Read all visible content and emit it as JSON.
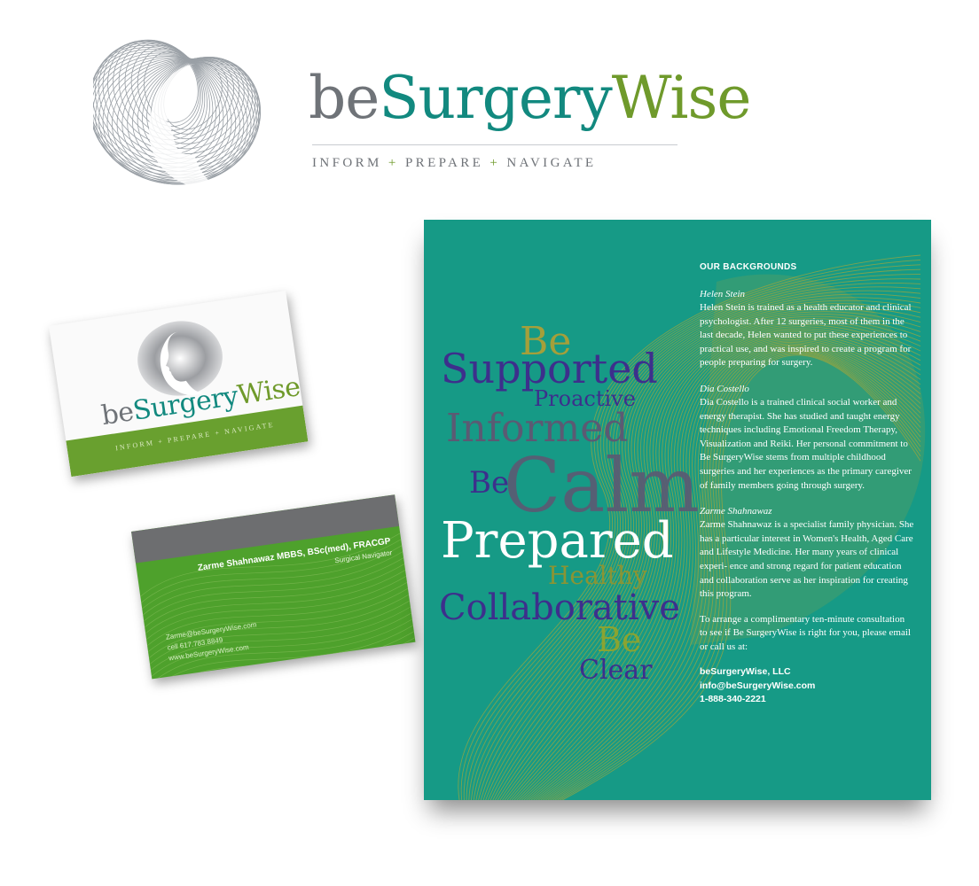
{
  "logo": {
    "word_be": "be",
    "word_surgery": "Surgery",
    "word_wise": "Wise",
    "tag_inform": "INFORM",
    "tag_prepare": "PREPARE",
    "tag_navigate": "NAVIGATE",
    "tag_plus": "+"
  },
  "card_front": {
    "word_be": "be",
    "word_surgery": "Surgery",
    "word_wise": "Wise",
    "tagline": "INFORM + PREPARE + NAVIGATE"
  },
  "card_back": {
    "name": "Zarme Shahnawaz MBBS, BSc(med), FRACGP",
    "role": "Surgical Navigator",
    "email": "Zarme@beSurgeryWise.com",
    "cell": "cell 617.783.8849",
    "web": "www.beSurgeryWise.com"
  },
  "brochure": {
    "words": {
      "be1": "Be",
      "supported": "Supported",
      "proactive": "Proactive",
      "informed": "Informed",
      "be2": "Be",
      "calm": "Calm",
      "prepared": "Prepared",
      "healthy": "Healthy",
      "collaborative": "Collaborative",
      "be3": "Be",
      "clear": "Clear"
    },
    "heading": "OUR BACKGROUNDS",
    "people": [
      {
        "name": "Helen Stein",
        "bio": "Helen Stein is trained as a health educator and clinical psychologist.  After 12 surgeries, most of them in the last decade, Helen wanted to put these experiences to practical use, and was inspired to create a program for people preparing for surgery."
      },
      {
        "name": "Dia Costello",
        "bio": "Dia Costello is a trained clinical social worker and energy therapist. She has studied and taught energy techniques including Emotional Freedom Therapy, Visualization and Reiki. Her personal commitment to Be SurgeryWise stems from multiple childhood surgeries and her experiences as the primary caregiver of family members going through surgery."
      },
      {
        "name": "Zarme Shahnawaz",
        "bio": "Zarme Shahnawaz is a specialist family physician. She has a particular interest in Women's Health, Aged Care and Lifestyle Medicine. Her many years of clinical experi- ence and strong regard for patient education and collaboration serve as her inspiration for creating this program."
      }
    ],
    "cta": "To arrange a complimentary ten-minute consultation to see if Be SurgeryWise is right for you, please email or call us at:",
    "company": "beSurgeryWise, LLC",
    "email": "info@beSurgeryWise.com",
    "phone": "1-888-340-2221"
  },
  "colors": {
    "teal": "#169a86",
    "green": "#69a02f",
    "gray": "#6f7378",
    "navy": "#3a2f86",
    "olive": "#8aa431"
  }
}
